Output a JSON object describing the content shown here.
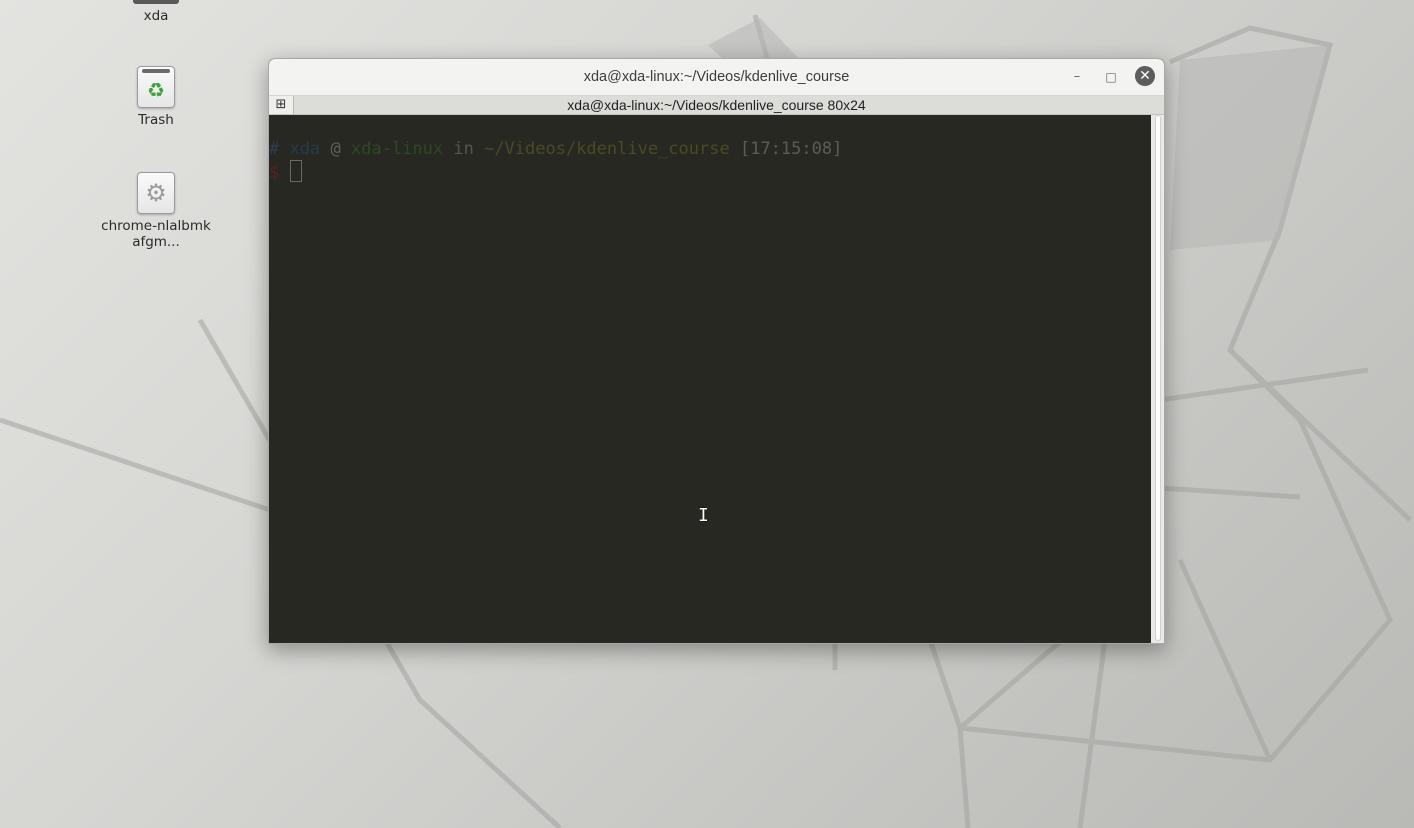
{
  "desktop": {
    "icons": [
      {
        "label": "xda",
        "icon": "home-folder-icon"
      },
      {
        "label": "Trash",
        "icon": "trash-icon"
      },
      {
        "label": "chrome-nlalbmkafgm...",
        "icon": "gear-icon"
      }
    ]
  },
  "window": {
    "title": "xda@xda-linux:~/Videos/kdenlive_course",
    "buttons": {
      "minimize": "–",
      "maximize": "□",
      "close": "✕"
    },
    "tab": {
      "menu_glyph": "⊞",
      "label": "xda@xda-linux:~/Videos/kdenlive_course 80x24"
    }
  },
  "terminal": {
    "prompt": {
      "hash": "#",
      "user": "xda",
      "at": "@",
      "host": "xda-linux",
      "in": "in",
      "path": "~/Videos/kdenlive_course",
      "time": "[17:15:08]",
      "dollar": "$"
    },
    "colors": {
      "background": "#272822",
      "hash": "#2b3e55",
      "user": "#233c4e",
      "host": "#2c4a22",
      "path": "#4c4a22",
      "dollar": "#5e2020"
    }
  },
  "mouse_cursor": "text-ibeam-cursor"
}
